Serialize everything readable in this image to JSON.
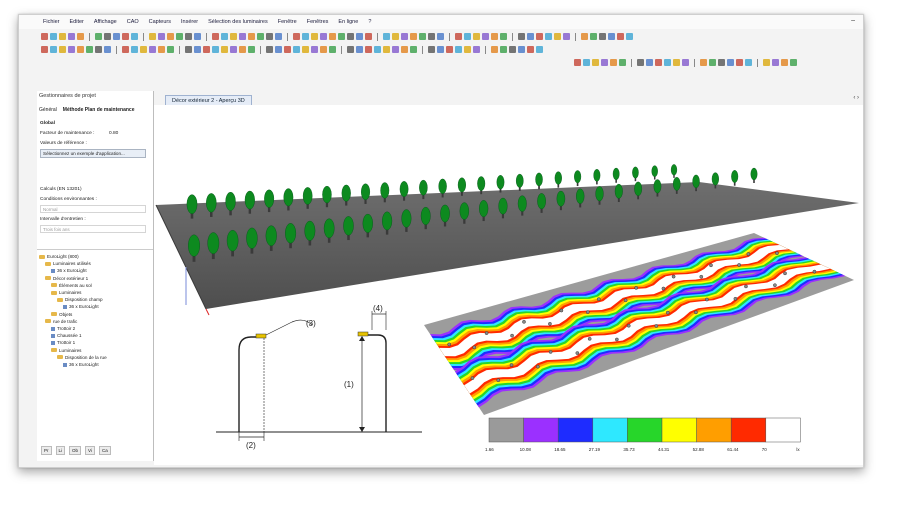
{
  "menu": [
    "Fichier",
    "Editer",
    "Affichage",
    "CAO",
    "Capteurs",
    "Insérer",
    "Sélection des luminaires",
    "Fenêtre",
    "Fenêtres",
    "En ligne",
    "?"
  ],
  "left_panel": {
    "title": "Gestionnaires de projet",
    "tabs": [
      "Général",
      "Méthode Plan de maintenance"
    ],
    "section_global": "Global",
    "maintenance_label": "Facteur de maintenance :",
    "maintenance_value": "0.80",
    "reference_label": "Valeurs de référence :",
    "select_button": "Sélectionnez un exemple d'application...",
    "norm_label": "Calculs (EN 13201)",
    "env_label": "Conditions environnantes :",
    "env_value": "Normal",
    "interval_label": "Intervalle d'entretien :",
    "interval_value": "Trois fois ans",
    "tree": [
      "EuroLight (800)",
      "Luminaires utilisés",
      "36 x EuroLight",
      "Décor extérieur 1",
      "Éléments au sol",
      "Luminaires",
      "Disposition champ",
      "36 x EuroLight",
      "Objets",
      "rue de trafic",
      "Trottoir 2",
      "Chaussée 1",
      "Trottoir 1",
      "Luminaires",
      "Disposition de la rue",
      "36 x EuroLight"
    ],
    "bottom_tabs": [
      "Pr",
      "Li",
      "Ob",
      "Vi",
      "Ca"
    ]
  },
  "doc_tab": "Décor extérieur 2 - Aperçu 3D",
  "diagram_labels": [
    "(1)",
    "(2)",
    "(3)",
    "(4)"
  ],
  "legend": {
    "colors": [
      "#9a9a9a",
      "#9b30ff",
      "#1e2cff",
      "#2ee8ff",
      "#27d62a",
      "#ffff00",
      "#ff9e00",
      "#ff2a00",
      "#ffffff"
    ],
    "values": [
      "1.66",
      "10.08",
      "18.65",
      "27.19",
      "35.73",
      "44.31",
      "52.88",
      "61.44",
      "70",
      "lx"
    ]
  },
  "accent_colors": {
    "tree": "#0d8a1f",
    "road": "#5a5a5a",
    "tab": "#e5ecf7"
  }
}
